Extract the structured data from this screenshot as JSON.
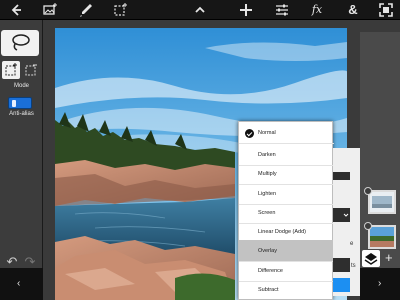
{
  "colors": {
    "toolbar_bg": "#161616",
    "panel_bg": "#3c3c3c",
    "menu_bg": "#ffffff",
    "selected_row": "#c2c2c2",
    "accent_blue": "#1c8ff2"
  },
  "toolbar": {
    "icons": [
      "back-arrow-icon",
      "image-add-icon",
      "brush-icon",
      "selection-icon",
      "chevron-up-icon",
      "add-icon",
      "adjustments-icon",
      "effects-fx-icon",
      "ampersand-icon",
      "fullscreen-icon"
    ],
    "fx_label": "fx",
    "amp_label": "&"
  },
  "tools": {
    "mode_label": "Mode",
    "antialias_label": "Anti-alias"
  },
  "blend_menu": {
    "items": [
      "Normal",
      "Darken",
      "Multiply",
      "Lighten",
      "Screen",
      "Linear Dodge (Add)",
      "Overlay",
      "Difference",
      "Subtract"
    ],
    "checked": "Normal",
    "highlighted": "Overlay"
  },
  "props_peek": {
    "text_fragment_1": "e",
    "text_fragment_2": "ts"
  },
  "nav": {
    "left_arrow": "‹",
    "right_arrow": "›",
    "plus": "+"
  }
}
